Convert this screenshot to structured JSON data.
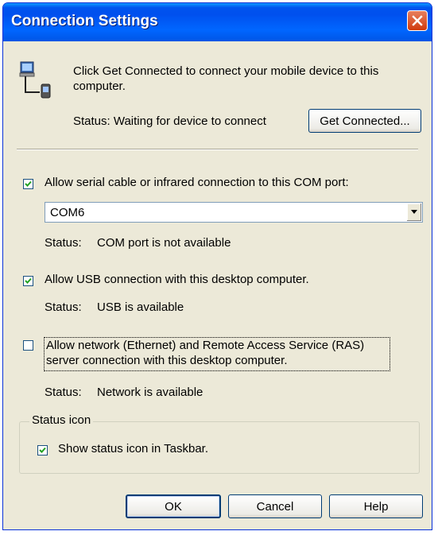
{
  "window": {
    "title": "Connection Settings",
    "close_icon": "close-icon"
  },
  "intro": {
    "icon": "device-connection-icon",
    "text_line1": "Click Get Connected to connect your mobile device to this",
    "text_line2": "computer.",
    "status": "Status: Waiting for device to connect",
    "get_connected_label": "Get Connected..."
  },
  "serial": {
    "checked": true,
    "label": "Allow serial cable or infrared connection to this COM port:",
    "port_value": "COM6",
    "status_label": "Status:",
    "status_value": "COM port is not available"
  },
  "usb": {
    "checked": true,
    "label": "Allow USB connection with this desktop computer.",
    "status_label": "Status:",
    "status_value": "USB is available"
  },
  "network": {
    "checked": false,
    "label_line1": "Allow network (Ethernet) and Remote Access Service (RAS)",
    "label_line2": "server connection with this desktop computer.",
    "status_label": "Status:",
    "status_value": "Network is available"
  },
  "status_icon_group": {
    "legend": "Status icon",
    "checked": true,
    "label": "Show status icon in Taskbar."
  },
  "buttons": {
    "ok": "OK",
    "cancel": "Cancel",
    "help": "Help"
  }
}
